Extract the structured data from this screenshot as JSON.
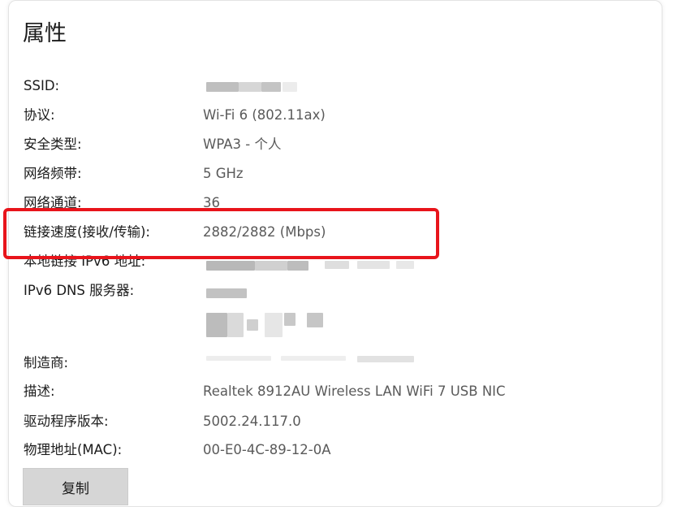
{
  "title": "属性",
  "properties": [
    {
      "label": "SSID:",
      "value": ""
    },
    {
      "label": "协议:",
      "value": "Wi-Fi 6 (802.11ax)"
    },
    {
      "label": "安全类型:",
      "value": "WPA3 - 个人"
    },
    {
      "label": "网络频带:",
      "value": "5 GHz"
    },
    {
      "label": "网络通道:",
      "value": "36"
    },
    {
      "label": "链接速度(接收/传输):",
      "value": "2882/2882 (Mbps)"
    },
    {
      "label": "本地链接 IPv6 地址:",
      "value": ""
    },
    {
      "label": "IPv6 DNS 服务器:",
      "value": ""
    },
    {
      "label": "制造商:",
      "value": ""
    },
    {
      "label": "描述:",
      "value": "Realtek 8912AU Wireless LAN WiFi 7 USB NIC"
    },
    {
      "label": "驱动程序版本:",
      "value": "5002.24.117.0"
    },
    {
      "label": "物理地址(MAC):",
      "value": "00-E0-4C-89-12-0A"
    }
  ],
  "copy_button": "复制",
  "colors": {
    "highlight": "#e8141b",
    "label": "#1b1b1b",
    "value": "#5a5a5a",
    "button": "#d6d6d6"
  }
}
